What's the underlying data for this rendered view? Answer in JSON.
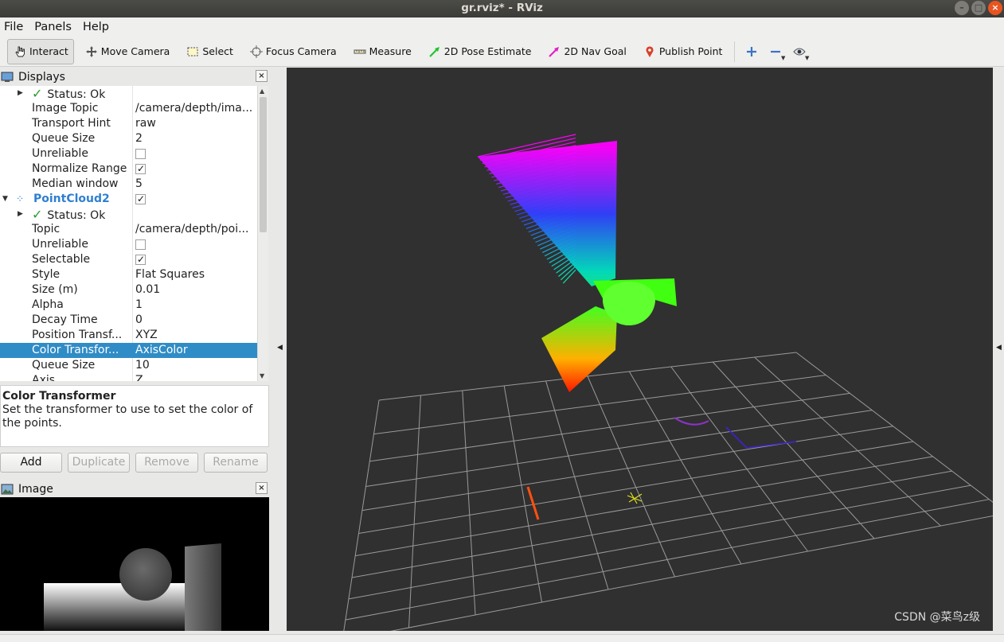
{
  "window": {
    "title": "gr.rviz* - RViz"
  },
  "menus": [
    "File",
    "Panels",
    "Help"
  ],
  "toolbar": {
    "tools": [
      {
        "label": "Interact",
        "icon": "hand-pointer-icon",
        "active": true
      },
      {
        "label": "Move Camera",
        "icon": "move-camera-icon"
      },
      {
        "label": "Select",
        "icon": "select-box-icon"
      },
      {
        "label": "Focus Camera",
        "icon": "focus-crosshair-icon"
      },
      {
        "label": "Measure",
        "icon": "ruler-icon"
      },
      {
        "label": "2D Pose Estimate",
        "icon": "green-arrow-icon",
        "color": "#22c42e"
      },
      {
        "label": "2D Nav Goal",
        "icon": "magenta-arrow-icon",
        "color": "#e020c8"
      },
      {
        "label": "Publish Point",
        "icon": "map-pin-icon",
        "color": "#d8402a"
      }
    ]
  },
  "displays_panel": {
    "title": "Displays",
    "rows": [
      {
        "name": "Status: Ok",
        "value": "",
        "status": true
      },
      {
        "name": "Image Topic",
        "value": "/camera/depth/ima..."
      },
      {
        "name": "Transport Hint",
        "value": "raw"
      },
      {
        "name": "Queue Size",
        "value": "2"
      },
      {
        "name": "Unreliable",
        "checkbox": false
      },
      {
        "name": "Normalize Range",
        "checkbox": true
      },
      {
        "name": "Median window",
        "value": "5"
      },
      {
        "name": "PointCloud2",
        "checkbox": true,
        "group": true
      },
      {
        "name": "Status: Ok",
        "value": "",
        "status": true
      },
      {
        "name": "Topic",
        "value": "/camera/depth/poi..."
      },
      {
        "name": "Unreliable",
        "checkbox": false
      },
      {
        "name": "Selectable",
        "checkbox": true
      },
      {
        "name": "Style",
        "value": "Flat Squares"
      },
      {
        "name": "Size (m)",
        "value": "0.01"
      },
      {
        "name": "Alpha",
        "value": "1"
      },
      {
        "name": "Decay Time",
        "value": "0"
      },
      {
        "name": "Position Transf...",
        "value": "XYZ"
      },
      {
        "name": "Color Transfor...",
        "value": "AxisColor",
        "selected": true
      },
      {
        "name": "Queue Size",
        "value": "10"
      },
      {
        "name": "Axis",
        "value": "Z"
      }
    ]
  },
  "description": {
    "title": "Color Transformer",
    "text": "Set the transformer to use to set the color of the points."
  },
  "buttons": {
    "add": "Add",
    "duplicate": "Duplicate",
    "remove": "Remove",
    "rename": "Rename"
  },
  "image_panel": {
    "title": "Image"
  },
  "watermark": "CSDN @菜鸟z级"
}
